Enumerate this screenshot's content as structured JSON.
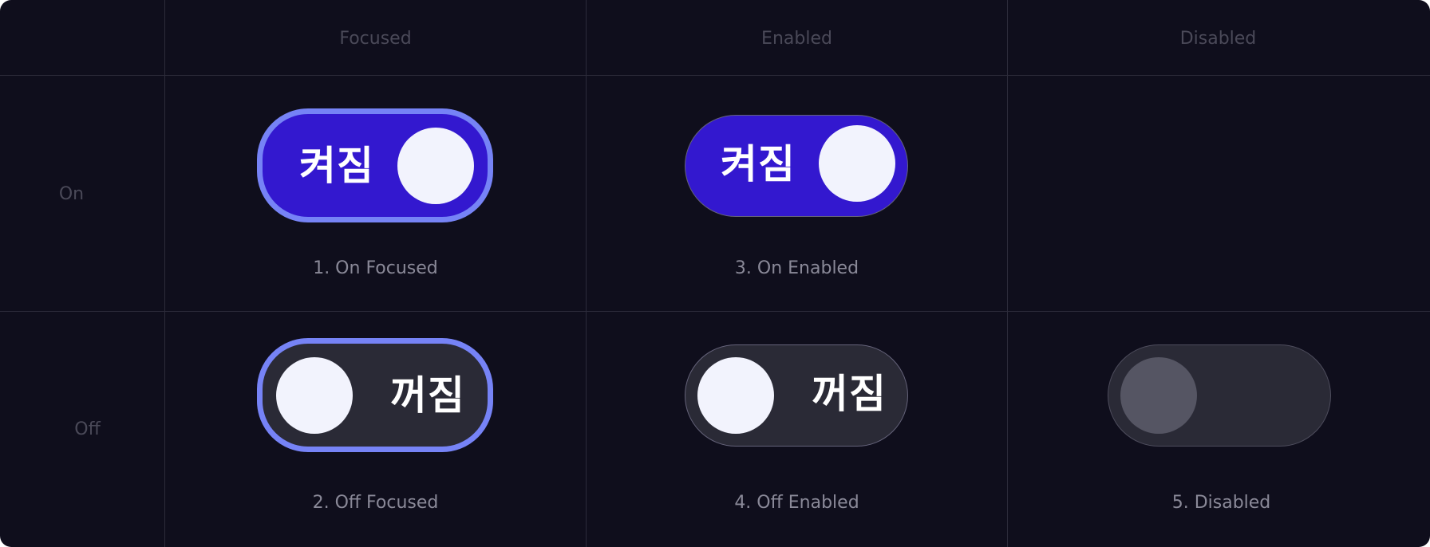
{
  "columns": [
    "Focused",
    "Enabled",
    "Disabled"
  ],
  "rows": [
    "On",
    "Off"
  ],
  "toggles": {
    "on_label": "켜짐",
    "off_label": "꺼짐"
  },
  "captions": {
    "on_focused": "1. On Focused",
    "off_focused": "2. Off Focused",
    "on_enabled": "3. On Enabled",
    "off_enabled": "4. Off Enabled",
    "disabled": "5. Disabled"
  },
  "colors": {
    "background": "#0f0e1c",
    "grid_line": "#2c2b3a",
    "on_track": "#3318cf",
    "off_track": "#2a2a36",
    "focus_ring": "#7683f6",
    "knob": "#f2f3fd",
    "disabled_knob": "#555563"
  }
}
